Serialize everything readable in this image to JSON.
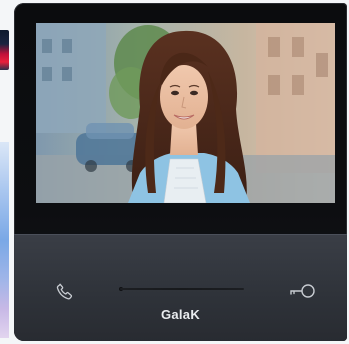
{
  "device": {
    "brand": "GalaK",
    "buttons": {
      "call_icon": "phone-icon",
      "unlock_icon": "key-icon"
    }
  },
  "colors": {
    "body": "#0b0c0e",
    "panel": "#30343b",
    "brand_text": "#e9ecef"
  }
}
